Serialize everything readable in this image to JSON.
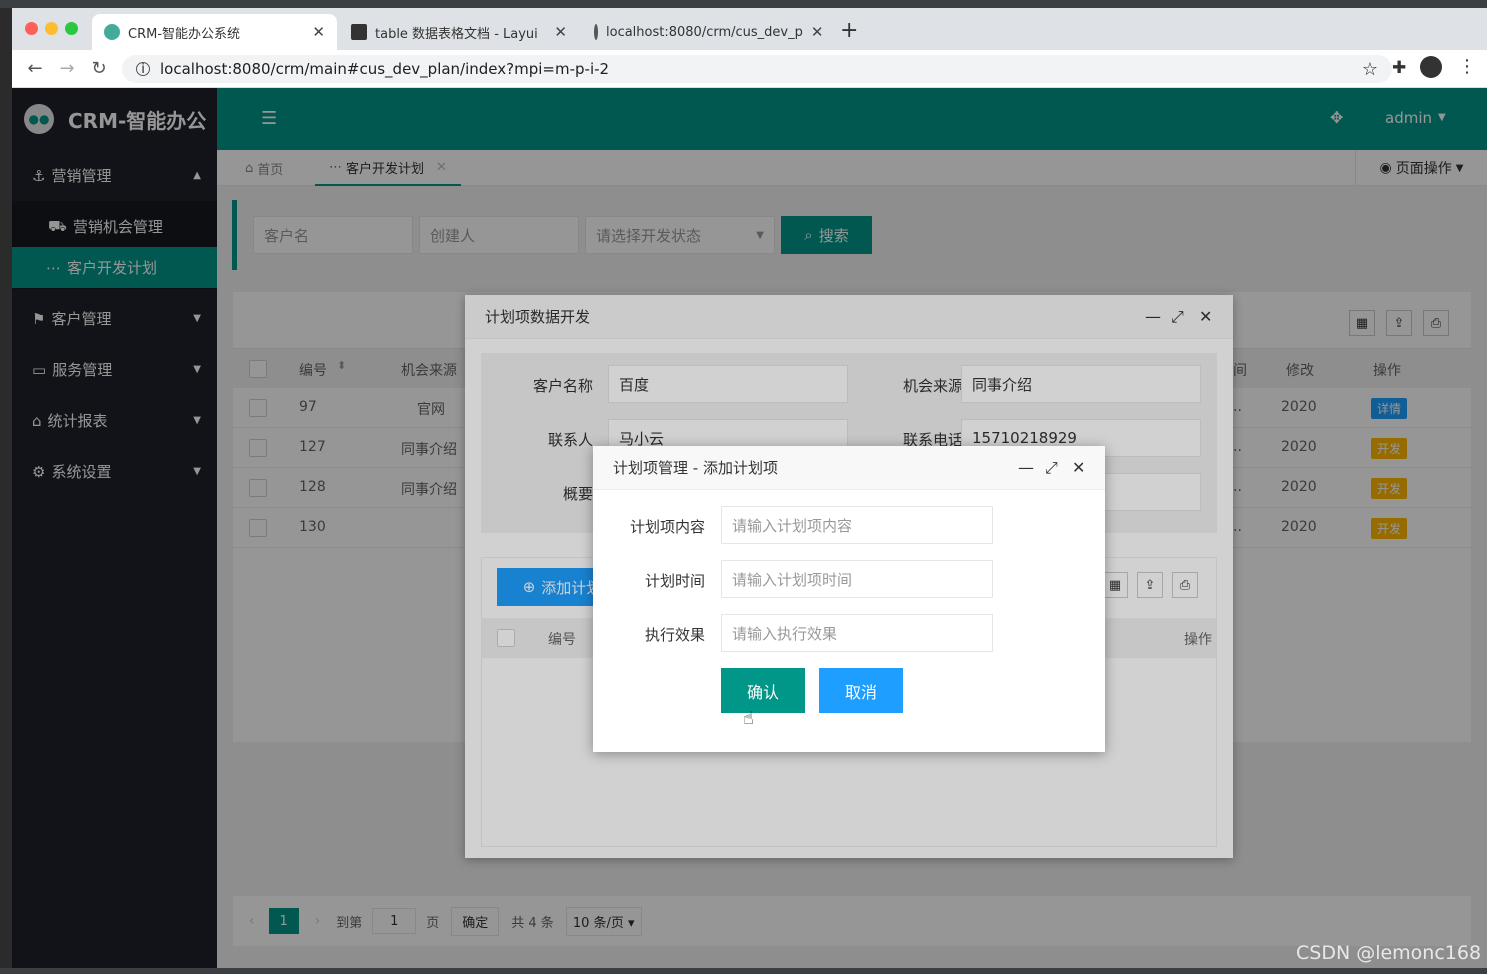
{
  "browser": {
    "tabs": [
      {
        "title": "CRM-智能办公系统",
        "active": true
      },
      {
        "title": "table 数据表格文档 - Layui",
        "active": false
      },
      {
        "title": "localhost:8080/crm/cus_dev_p",
        "active": false
      }
    ],
    "url": "localhost:8080/crm/main#cus_dev_plan/index?mpi=m-p-i-2",
    "new_tab": "+"
  },
  "app": {
    "logo_text": "CRM-智能办公",
    "user": "admin",
    "page_ops": "页面操作"
  },
  "sidebar": {
    "items": [
      {
        "label": "营销管理",
        "icon": "anchor-icon",
        "expanded": true
      },
      {
        "label": "客户管理",
        "icon": "flag-icon"
      },
      {
        "label": "服务管理",
        "icon": "monitor-icon"
      },
      {
        "label": "统计报表",
        "icon": "home-icon"
      },
      {
        "label": "系统设置",
        "icon": "gears-icon"
      }
    ],
    "sub_items": [
      {
        "label": "营销机会管理",
        "active": false
      },
      {
        "label": "客户开发计划",
        "active": true
      }
    ]
  },
  "page_tabs": [
    {
      "label": "首页"
    },
    {
      "label": "客户开发计划",
      "active": true
    }
  ],
  "search": {
    "customer_placeholder": "客户名",
    "creator_placeholder": "创建人",
    "status_placeholder": "请选择开发状态",
    "search_label": "搜索"
  },
  "table": {
    "headers": {
      "id": "编号",
      "source": "机会来源",
      "col_right": "间",
      "modified": "修改",
      "ops": "操作"
    },
    "rows": [
      {
        "id": "97",
        "source": "官网",
        "trunc": "..",
        "modified": "2020",
        "op": "详情",
        "op_color": "#1e9fff"
      },
      {
        "id": "127",
        "source": "同事介绍",
        "trunc": "..",
        "modified": "2020",
        "op": "开发",
        "op_color": "#ffb800"
      },
      {
        "id": "128",
        "source": "同事介绍",
        "trunc": "..",
        "modified": "2020",
        "op": "开发",
        "op_color": "#ffb800"
      },
      {
        "id": "130",
        "source": "",
        "trunc": "..",
        "modified": "2020",
        "op": "开发",
        "op_color": "#ffb800"
      }
    ]
  },
  "pager": {
    "current": "1",
    "goto_label": "到第",
    "goto_value": "1",
    "page_unit": "页",
    "confirm": "确定",
    "total": "共 4 条",
    "per_page": "10 条/页"
  },
  "modal1": {
    "title": "计划项数据开发",
    "fields": {
      "customer_label": "客户名称",
      "customer_value": "百度",
      "source_label": "机会来源",
      "source_value": "同事介绍",
      "contact_label": "联系人",
      "contact_value": "马小云",
      "phone_label": "联系电话",
      "phone_value": "15710218929",
      "summary_label": "概要"
    },
    "add_btn": "添加计划",
    "sub_headers": {
      "id": "编号",
      "ops": "操作"
    }
  },
  "modal2": {
    "title": "计划项管理 - 添加计划项",
    "content_label": "计划项内容",
    "content_placeholder": "请输入计划项内容",
    "time_label": "计划时间",
    "time_placeholder": "请输入计划项时间",
    "effect_label": "执行效果",
    "effect_placeholder": "请输入执行效果",
    "confirm": "确认",
    "cancel": "取消"
  },
  "watermark": "CSDN @lemonc168"
}
